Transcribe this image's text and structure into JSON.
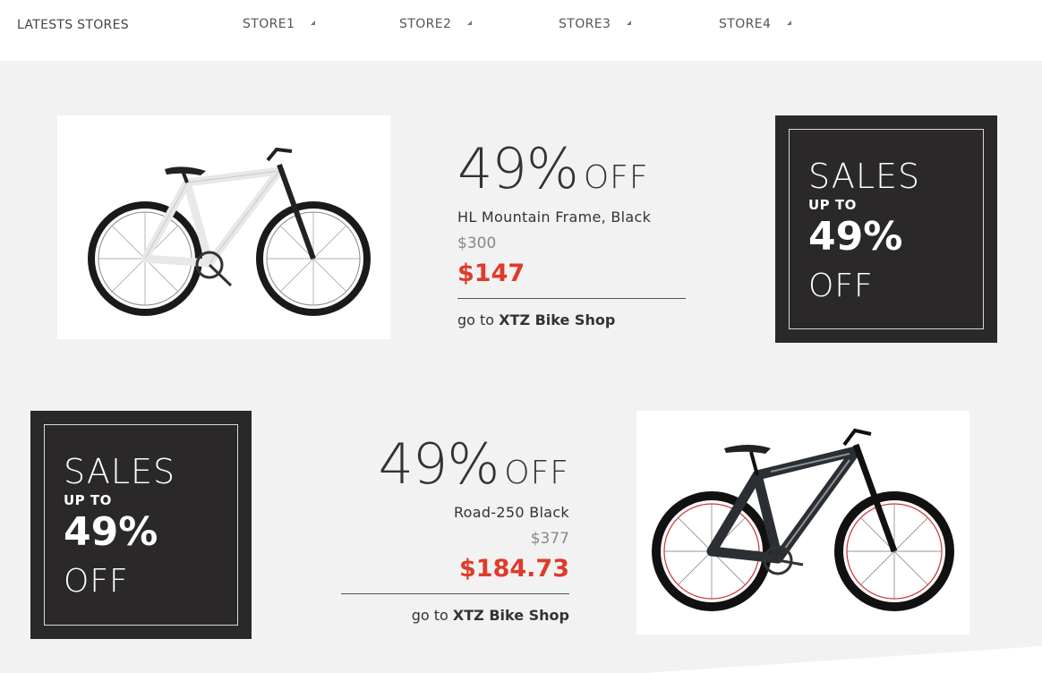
{
  "header": {
    "brand": "LATESTS STORES",
    "stores": [
      "STORE1",
      "STORE2",
      "STORE3",
      "STORE4"
    ]
  },
  "offers": [
    {
      "percent": "49%",
      "off": "OFF",
      "name": "HL Mountain Frame, Black",
      "old_price": "$300",
      "new_price": "$147",
      "go_prefix": "go to",
      "shop": "XTZ Bike Shop",
      "image_icon": "bicycle-white-icon"
    },
    {
      "percent": "49%",
      "off": "OFF",
      "name": "Road-250 Black",
      "old_price": "$377",
      "new_price": "$184.73",
      "go_prefix": "go to",
      "shop": "XTZ Bike Shop",
      "image_icon": "bicycle-black-icon"
    }
  ],
  "banners": [
    {
      "line1": "SALES",
      "line2": "UP TO",
      "line3": "49%",
      "line4": "OFF"
    },
    {
      "line1": "SALES",
      "line2": "UP TO",
      "line3": "49%",
      "line4": "OFF"
    }
  ],
  "colors": {
    "accent_price": "#e03a2b",
    "banner_bg": "#2a2828",
    "page_bg": "#f2f2f2"
  }
}
